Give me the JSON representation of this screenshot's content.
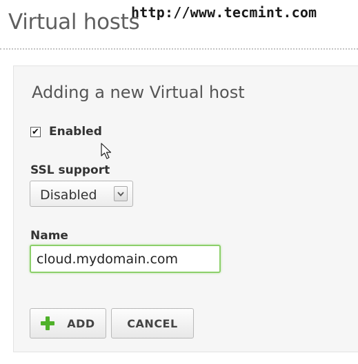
{
  "header": {
    "title": "Virtual hosts",
    "watermark": "http://www.tecmint.com"
  },
  "form": {
    "title": "Adding a new Virtual host",
    "enabled": {
      "label": "Enabled",
      "checked": true
    },
    "ssl": {
      "label": "SSL support",
      "selected": "Disabled"
    },
    "name": {
      "label": "Name",
      "value": "cloud.mydomain.com"
    },
    "buttons": {
      "add_label": "ADD",
      "cancel_label": "CANCEL"
    }
  },
  "colors": {
    "accent_green": "#4fb12a",
    "focus_border": "#8ccf6a"
  },
  "icons": [
    "checkmark-icon",
    "mouse-cursor-icon",
    "chevron-down-icon",
    "plus-icon"
  ]
}
